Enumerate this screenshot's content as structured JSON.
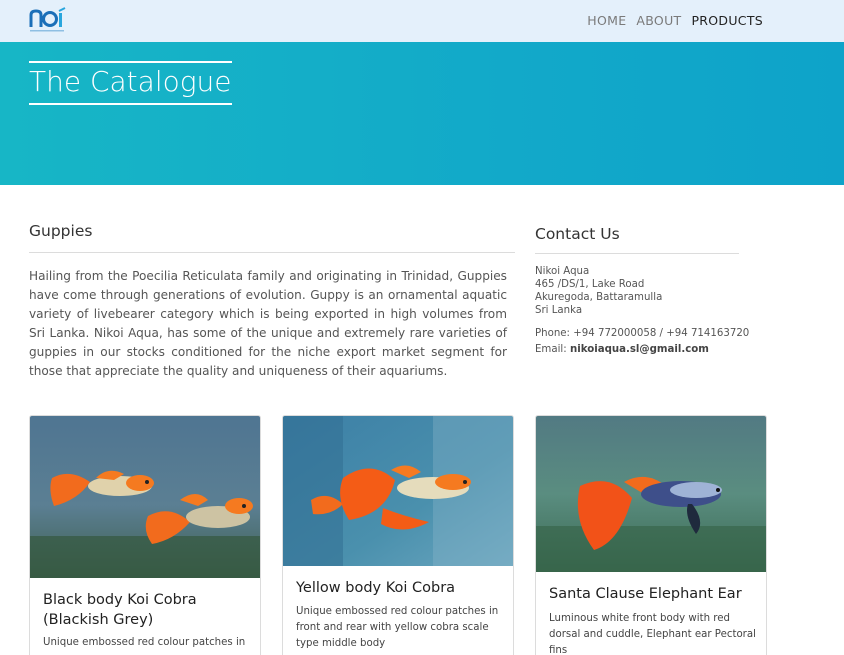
{
  "nav": {
    "items": [
      {
        "label": "HOME",
        "active": false
      },
      {
        "label": "ABOUT",
        "active": false
      },
      {
        "label": "PRODUCTS",
        "active": true
      }
    ]
  },
  "hero": {
    "title": "The Catalogue",
    "gradient_start": "#17b6c6",
    "gradient_end": "#0ea3c9"
  },
  "guppies": {
    "heading": "Guppies",
    "intro": "Hailing from the Poecilia Reticulata family and originating in Trinidad, Guppies have come through generations of evolution. Guppy is an ornamental aquatic variety of livebearer category which is being exported in high volumes from Sri Lanka. Nikoi Aqua, has some of the unique and extremely rare varieties of guppies in our stocks conditioned for the niche export market segment for those that appreciate the quality and uniqueness of their aquariums."
  },
  "contact": {
    "heading": "Contact Us",
    "name": "Nikoi Aqua",
    "address1": "465 /DS/1, Lake Road",
    "address2": "Akuregoda, Battaramulla",
    "address3": "Sri Lanka",
    "phone": "Phone: +94 772000058 / +94 714163720",
    "email_label": "Email:",
    "email": "nikoiaqua.sl@gmail.com"
  },
  "products": [
    {
      "title": "Black body Koi Cobra (Blackish Grey)",
      "description": "Unique embossed red colour patches in"
    },
    {
      "title": "Yellow body Koi Cobra",
      "description": "Unique embossed red colour patches in front and rear with yellow cobra scale type middle body"
    },
    {
      "title": "Santa Clause Elephant Ear",
      "description": "Luminous white front body with red dorsal and cuddle, Elephant ear Pectoral fins"
    }
  ]
}
